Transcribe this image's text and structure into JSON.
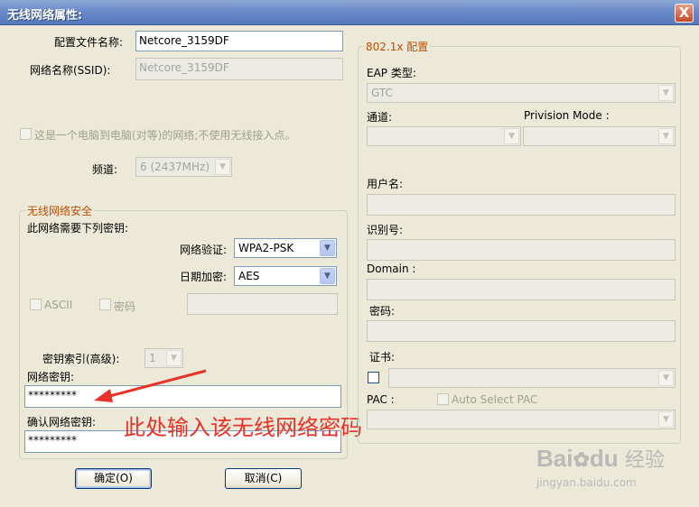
{
  "window": {
    "title": "无线网络属性:",
    "close_label": "X"
  },
  "left": {
    "profile_name_label": "配置文件名称:",
    "profile_name_value": "Netcore_3159DF",
    "ssid_label": "网络名称(SSID):",
    "ssid_value": "Netcore_3159DF",
    "adhoc_label": "这是一个电脑到电脑(对等)的网络;不使用无线接入点。",
    "channel_label": "频道:",
    "channel_value": "6 (2437MHz)"
  },
  "security": {
    "legend": "无线网络安全",
    "needs_key_label": "此网络需要下列密钥:",
    "auth_label": "网络验证:",
    "auth_value": "WPA2-PSK",
    "encryption_label": "日期加密:",
    "encryption_value": "AES",
    "ascii_label": "ASCII",
    "password_label": "密码",
    "key_index_label": "密钥索引(高级):",
    "key_index_value": "1",
    "network_key_label": "网络密钥:",
    "network_key_value": "*********",
    "confirm_key_label": "确认网络密钥:",
    "confirm_key_value": "*********"
  },
  "buttons": {
    "ok_label": "确定(O)",
    "cancel_label": "取消(C)"
  },
  "eap_panel": {
    "legend": "802.1x 配置",
    "eap_type_label": "EAP 类型:",
    "eap_type_value": "GTC",
    "tunnel_label": "通道:",
    "provision_label": "Privision Mode :",
    "username_label": "用户名:",
    "identity_label": "识别号:",
    "domain_label": "Domain :",
    "password_label": "密码:",
    "cert_label": "证书:",
    "pac_label": "PAC :",
    "auto_pac_label": "Auto Select PAC"
  },
  "annotation": {
    "text": "此处输入该无线网络密码",
    "color": "#e8332a"
  },
  "watermark": {
    "brand": "Bai",
    "brand2": "du",
    "jingyan": "经验",
    "url": "jingyan.baidu.com"
  }
}
